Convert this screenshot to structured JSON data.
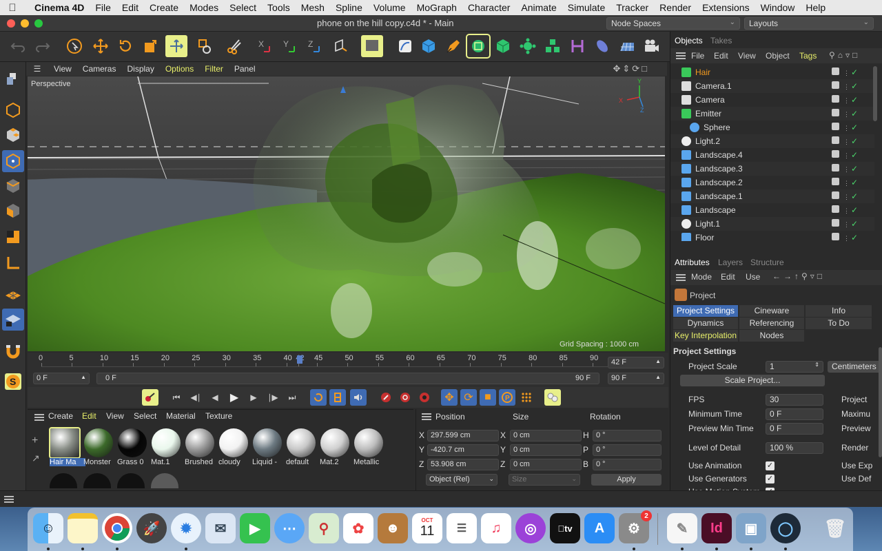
{
  "menubar": {
    "app_name": "Cinema 4D",
    "items": [
      "File",
      "Edit",
      "Create",
      "Modes",
      "Select",
      "Tools",
      "Mesh",
      "Spline",
      "Volume",
      "MoGraph",
      "Character",
      "Animate",
      "Simulate",
      "Tracker",
      "Render",
      "Extensions",
      "Window",
      "Help"
    ]
  },
  "window": {
    "title": "phone on the hill copy.c4d * - Main",
    "node_spaces": "Node Spaces",
    "layouts": "Layouts"
  },
  "viewport": {
    "menu": [
      "View",
      "Cameras",
      "Display",
      "Options",
      "Filter",
      "Panel"
    ],
    "highlighted_menu": [
      "Options",
      "Filter"
    ],
    "camera_label": "Perspective",
    "grid_spacing": "Grid Spacing : 1000 cm",
    "axis": {
      "x": "X",
      "y": "Y",
      "z": "Z"
    }
  },
  "timeline": {
    "ticks": [
      "0",
      "5",
      "10",
      "15",
      "20",
      "25",
      "30",
      "35",
      "40",
      "42",
      "45",
      "50",
      "55",
      "60",
      "65",
      "70",
      "75",
      "80",
      "85",
      "90"
    ],
    "current_frame_field": "42 F",
    "start_field": "0 F",
    "range_start": "0 F",
    "range_end": "90 F",
    "end_field": "90 F"
  },
  "materials": {
    "menu": [
      "Create",
      "Edit",
      "View",
      "Select",
      "Material",
      "Texture"
    ],
    "highlighted_menu": "Edit",
    "items": [
      {
        "label": "Hair Ma",
        "color": "#8a8f88",
        "selected": true
      },
      {
        "label": "Monster",
        "color": "#3c6a2a"
      },
      {
        "label": "Grass 0",
        "color": "#050505"
      },
      {
        "label": "Mat.1",
        "color": "#e9f7ec"
      },
      {
        "label": "Brushed",
        "color": "#9a9a9a"
      },
      {
        "label": "cloudy",
        "color": "#f2f2f2"
      },
      {
        "label": "Liquid -",
        "color": "#6d7a82"
      },
      {
        "label": "default",
        "color": "#c8c8c8"
      },
      {
        "label": "Mat.2",
        "color": "#d0d0d0"
      },
      {
        "label": "Metallic",
        "color": "#bdbdbd"
      }
    ]
  },
  "coordinates": {
    "headers": [
      "Position",
      "Size",
      "Rotation"
    ],
    "rows": [
      {
        "axis": "X",
        "pos": "297.599 cm",
        "size_axis": "X",
        "size": "0 cm",
        "rot_axis": "H",
        "rot": "0 °"
      },
      {
        "axis": "Y",
        "pos": "-420.7 cm",
        "size_axis": "Y",
        "size": "0 cm",
        "rot_axis": "P",
        "rot": "0 °"
      },
      {
        "axis": "Z",
        "pos": "53.908 cm",
        "size_axis": "Z",
        "size": "0 cm",
        "rot_axis": "B",
        "rot": "0 °"
      }
    ],
    "mode": "Object (Rel)",
    "size_mode": "Size",
    "apply": "Apply"
  },
  "objects": {
    "tabs": [
      "Objects",
      "Takes"
    ],
    "menu": [
      "File",
      "Edit",
      "View",
      "Object",
      "Tags"
    ],
    "items": [
      {
        "name": "Hair",
        "highlight": true,
        "icon": "hair-icon",
        "indent": 0
      },
      {
        "name": "Camera.1",
        "icon": "camera-icon",
        "indent": 0
      },
      {
        "name": "Camera",
        "icon": "camera-icon",
        "indent": 0
      },
      {
        "name": "Emitter",
        "icon": "emitter-icon",
        "indent": 0
      },
      {
        "name": "Sphere",
        "icon": "sphere-icon",
        "indent": 1
      },
      {
        "name": "Light.2",
        "icon": "light-icon",
        "indent": 0
      },
      {
        "name": "Landscape.4",
        "icon": "landscape-icon",
        "indent": 0
      },
      {
        "name": "Landscape.3",
        "icon": "landscape-icon",
        "indent": 0
      },
      {
        "name": "Landscape.2",
        "icon": "landscape-icon",
        "indent": 0
      },
      {
        "name": "Landscape.1",
        "icon": "landscape-icon",
        "indent": 0
      },
      {
        "name": "Landscape",
        "icon": "landscape-icon",
        "indent": 0
      },
      {
        "name": "Light.1",
        "icon": "light-icon",
        "indent": 0
      },
      {
        "name": "Floor",
        "icon": "floor-icon",
        "indent": 0
      }
    ]
  },
  "attributes": {
    "tabs": [
      "Attributes",
      "Layers",
      "Structure"
    ],
    "menu": [
      "Mode",
      "Edit",
      "Use"
    ],
    "object_label": "Project",
    "subtabs": [
      "Project Settings",
      "Cineware",
      "Info",
      "Dynamics",
      "Referencing",
      "To Do",
      "Key Interpolation",
      "Nodes"
    ],
    "section_title": "Project Settings",
    "project_scale_label": "Project Scale",
    "project_scale_value": "1",
    "project_scale_unit": "Centimeters",
    "scale_project_button": "Scale Project...",
    "fields": [
      {
        "label": "FPS",
        "value": "30",
        "right": "Project"
      },
      {
        "label": "Minimum Time",
        "value": "0 F",
        "right": "Maximu"
      },
      {
        "label": "Preview Min Time",
        "value": "0 F",
        "right": "Preview"
      },
      {
        "label": "Level of Detail",
        "value": "100 %",
        "right": "Render"
      }
    ],
    "checks": [
      {
        "label": "Use Animation",
        "right": "Use Exp"
      },
      {
        "label": "Use Generators",
        "right": "Use Def"
      },
      {
        "label": "Use Motion System",
        "right": ""
      }
    ]
  },
  "dock": {
    "calendar_month": "OCT",
    "calendar_day": "11",
    "prefs_badge": "2"
  }
}
